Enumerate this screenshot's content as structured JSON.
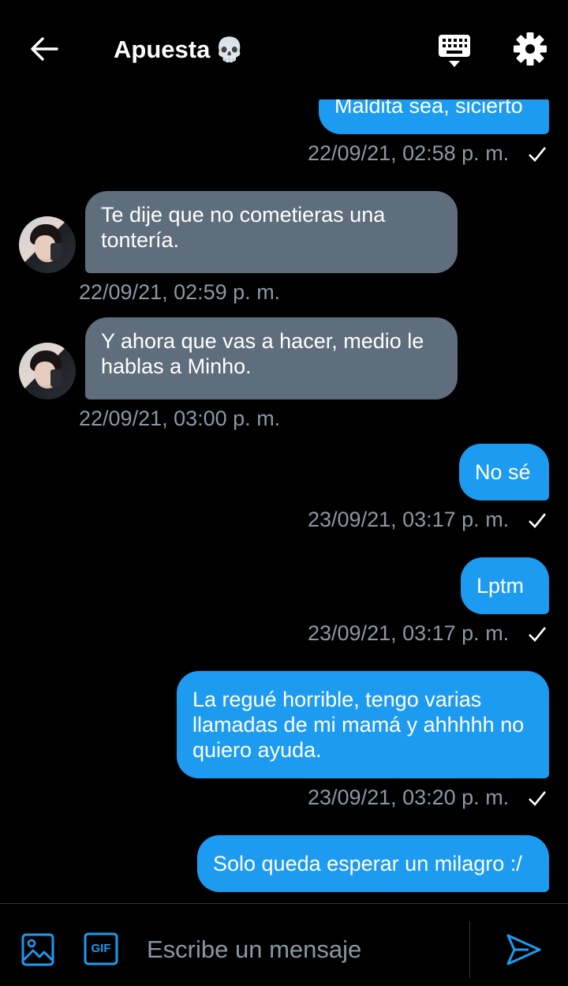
{
  "header": {
    "title": "Apuesta",
    "title_emoji": "💀",
    "back_icon": "arrow-left-icon",
    "keyboard_icon": "keyboard-icon",
    "settings_icon": "gear-icon"
  },
  "messages": [
    {
      "direction": "out",
      "text": "Maldita sea, sicierto",
      "time": "22/09/21, 02:58 p. m.",
      "sent": true
    },
    {
      "direction": "in",
      "text": "Te dije que no cometieras una tontería.",
      "time": "22/09/21, 02:59 p. m."
    },
    {
      "direction": "in",
      "text": "Y ahora que vas a hacer, medio le hablas a Minho.",
      "time": "22/09/21, 03:00 p. m."
    },
    {
      "direction": "out",
      "text": "No sé",
      "time": "23/09/21, 03:17 p. m.",
      "sent": true
    },
    {
      "direction": "out",
      "text": "Lptm",
      "time": "23/09/21, 03:17 p. m.",
      "sent": true
    },
    {
      "direction": "out",
      "text": "La regué horrible, tengo varias llamadas de mi mamá y ahhhhh no quiero ayuda.",
      "time": "23/09/21, 03:20 p. m.",
      "sent": true
    },
    {
      "direction": "out",
      "text": "Solo queda esperar un milagro :/",
      "time": "",
      "sent": true
    }
  ],
  "composer": {
    "placeholder": "Escribe un mensaje",
    "image_icon": "image-icon",
    "gif_label": "GIF",
    "send_icon": "send-icon"
  },
  "colors": {
    "background": "#000000",
    "outgoing_bubble": "#1d9bf0",
    "incoming_bubble": "#5f6e7d",
    "timestamp": "#8b98a5",
    "accent": "#1d9bf0"
  }
}
